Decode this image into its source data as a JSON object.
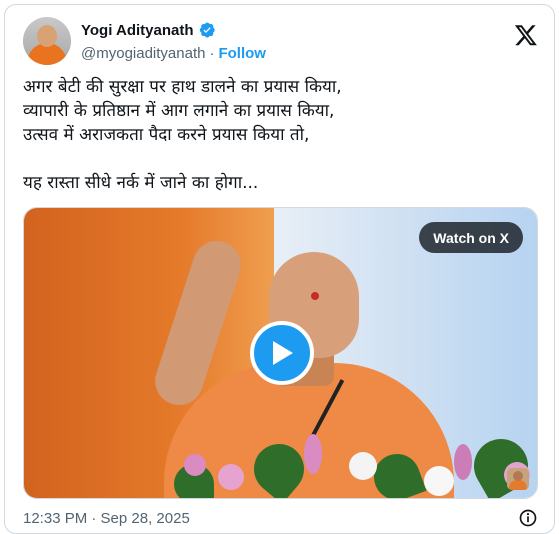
{
  "author": {
    "name": "Yogi Adityanath",
    "handle": "@myogiadityanath",
    "separator": "·",
    "follow_label": "Follow",
    "avatar_icon": "profile-photo",
    "verified_icon": "verified-badge-icon"
  },
  "brand": {
    "logo_icon": "x-logo-icon"
  },
  "tweet": {
    "text": "अगर बेटी की सुरक्षा पर हाथ डालने का प्रयास किया,\nव्यापारी के प्रतिष्ठान में आग लगाने का प्रयास किया,\nउत्सव में अराजकता पैदा करने प्रयास किया तो,\n\nयह रास्ता सीधे नर्क में जाने का होगा..."
  },
  "media": {
    "watch_label": "Watch on X",
    "play_icon": "play-icon"
  },
  "footer": {
    "timestamp": "12:33 PM · Sep 28, 2025",
    "info_icon": "info-icon"
  },
  "colors": {
    "accent": "#1d9bf0",
    "text": "#0f1419",
    "secondary": "#536471",
    "border": "#cfd9de"
  }
}
